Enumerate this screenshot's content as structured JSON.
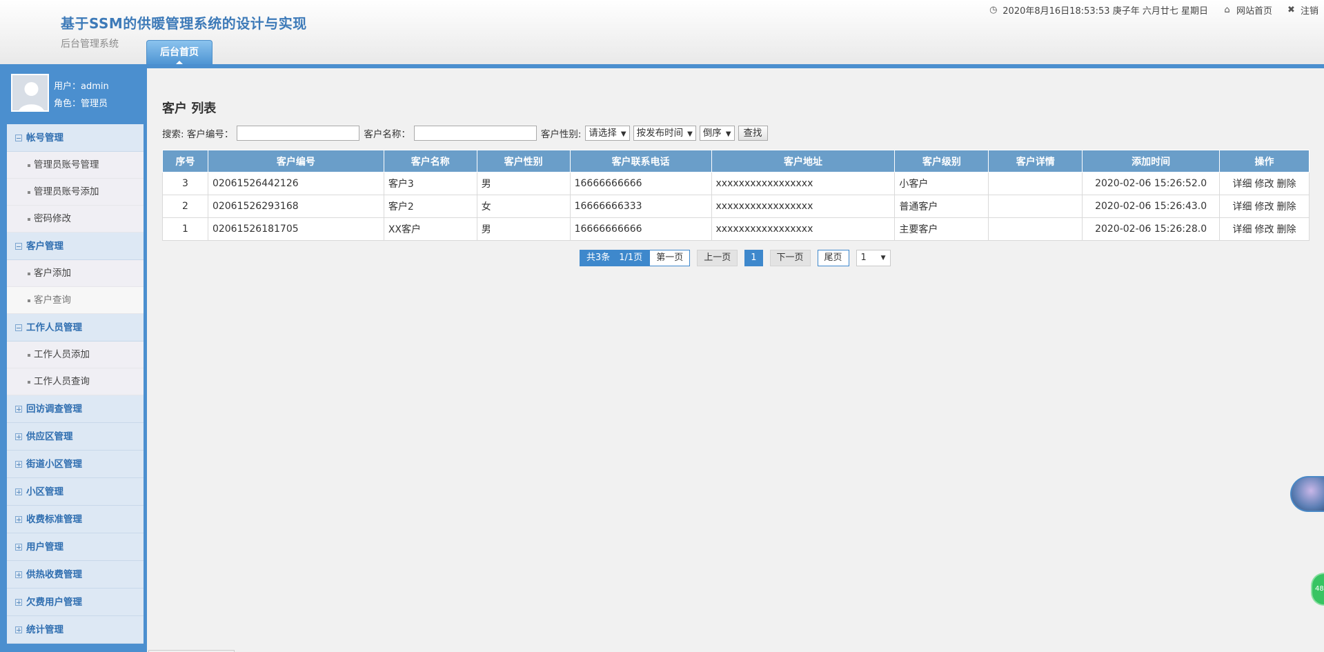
{
  "header": {
    "title": "基于SSM的供暖管理系统的设计与实现",
    "subtitle": "后台管理系统",
    "datetime": "2020年8月16日18:53:53 庚子年 六月廿七 星期日",
    "home_link": "网站首页",
    "logout_link": "注销",
    "tab_label": "后台首页"
  },
  "user": {
    "name_line": "用户：admin",
    "role_line": "角色：管理员"
  },
  "sidebar": {
    "groups": [
      {
        "label": "帐号管理",
        "items": [
          "管理员账号管理",
          "管理员账号添加",
          "密码修改"
        ]
      },
      {
        "label": "客户管理",
        "items": [
          "客户添加",
          "客户查询"
        ]
      },
      {
        "label": "工作人员管理",
        "items": [
          "工作人员添加",
          "工作人员查询"
        ]
      },
      {
        "label": "回访调查管理"
      },
      {
        "label": "供应区管理"
      },
      {
        "label": "街道小区管理"
      },
      {
        "label": "小区管理"
      },
      {
        "label": "收费标准管理"
      },
      {
        "label": "用户管理"
      },
      {
        "label": "供热收费管理"
      },
      {
        "label": "欠费用户管理"
      },
      {
        "label": "统计管理"
      }
    ]
  },
  "page": {
    "title": "客户 列表",
    "search": {
      "label_code": "搜索: 客户编号：",
      "label_name": "客户名称：",
      "label_sex": "客户性别:",
      "sex_select": "请选择",
      "sort_select": "按发布时间",
      "order_select": "倒序",
      "button": "查找",
      "code_value": "",
      "name_value": ""
    },
    "table": {
      "headers": [
        "序号",
        "客户编号",
        "客户名称",
        "客户性别",
        "客户联系电话",
        "客户地址",
        "客户级别",
        "客户详情",
        "添加时间",
        "操作"
      ],
      "rows": [
        {
          "no": "3",
          "code": "02061526442126",
          "name": "客户3",
          "sex": "男",
          "phone": "16666666666",
          "address": "xxxxxxxxxxxxxxxxx",
          "level": "小客户",
          "detail": "",
          "time": "2020-02-06 15:26:52.0"
        },
        {
          "no": "2",
          "code": "02061526293168",
          "name": "客户2",
          "sex": "女",
          "phone": "16666666333",
          "address": "xxxxxxxxxxxxxxxxx",
          "level": "普通客户",
          "detail": "",
          "time": "2020-02-06 15:26:43.0"
        },
        {
          "no": "1",
          "code": "02061526181705",
          "name": "XX客户",
          "sex": "男",
          "phone": "16666666666",
          "address": "xxxxxxxxxxxxxxxxx",
          "level": "主要客户",
          "detail": "",
          "time": "2020-02-06 15:26:28.0"
        }
      ],
      "actions": [
        "详细",
        "修改",
        "删除"
      ]
    },
    "pager": {
      "total": "共3条　1/1页",
      "first": "第一页",
      "prev": "上一页",
      "current": "1",
      "next": "下一页",
      "last": "尾页",
      "jump_value": "1"
    }
  },
  "widgets": {
    "green_badge": "48"
  }
}
